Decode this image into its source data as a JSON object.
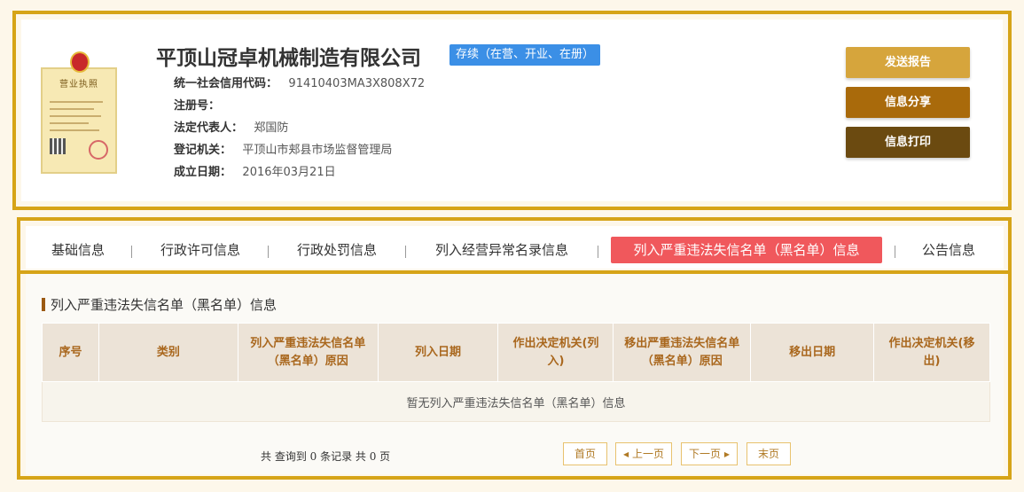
{
  "company": {
    "name": "平顶山冠卓机械制造有限公司",
    "status": "存续（在营、开业、在册）"
  },
  "license_image": {
    "title": "营业执照"
  },
  "info": [
    {
      "key": "统一社会信用代码：",
      "value": "91410403MA3X808X72"
    },
    {
      "key": "注册号：",
      "value": ""
    },
    {
      "key": "法定代表人：",
      "value": "郑国防"
    },
    {
      "key": "登记机关：",
      "value": "平顶山市郏县市场监督管理局"
    },
    {
      "key": "成立日期：",
      "value": "2016年03月21日"
    }
  ],
  "actions": {
    "send_report": "发送报告",
    "share": "信息分享",
    "print": "信息打印"
  },
  "tabs": [
    {
      "label": "基础信息"
    },
    {
      "label": "行政许可信息"
    },
    {
      "label": "行政处罚信息"
    },
    {
      "label": "列入经营异常名录信息"
    },
    {
      "label": "列入严重违法失信名单（黑名单）信息",
      "active": true
    },
    {
      "label": "公告信息"
    }
  ],
  "section": {
    "title": "列入严重违法失信名单（黑名单）信息",
    "columns": [
      "序号",
      "类别",
      "列入严重违法失信名单（黑名单）原因",
      "列入日期",
      "作出决定机关(列入)",
      "移出严重违法失信名单（黑名单）原因",
      "移出日期",
      "作出决定机关(移出)"
    ],
    "empty_text": "暂无列入严重违法失信名单（黑名单）信息"
  },
  "pager": {
    "summary": "共 查询到 0 条记录 共 0 页",
    "first": "首页",
    "prev": "上一页",
    "next": "下一页",
    "last": "末页"
  },
  "colors": {
    "border": "#d6a418",
    "active_tab": "#f0585c",
    "status_badge": "#3b8fe6",
    "btn_send": "#d6a53c",
    "btn_share": "#a96a0b",
    "btn_print": "#6b4a10"
  }
}
